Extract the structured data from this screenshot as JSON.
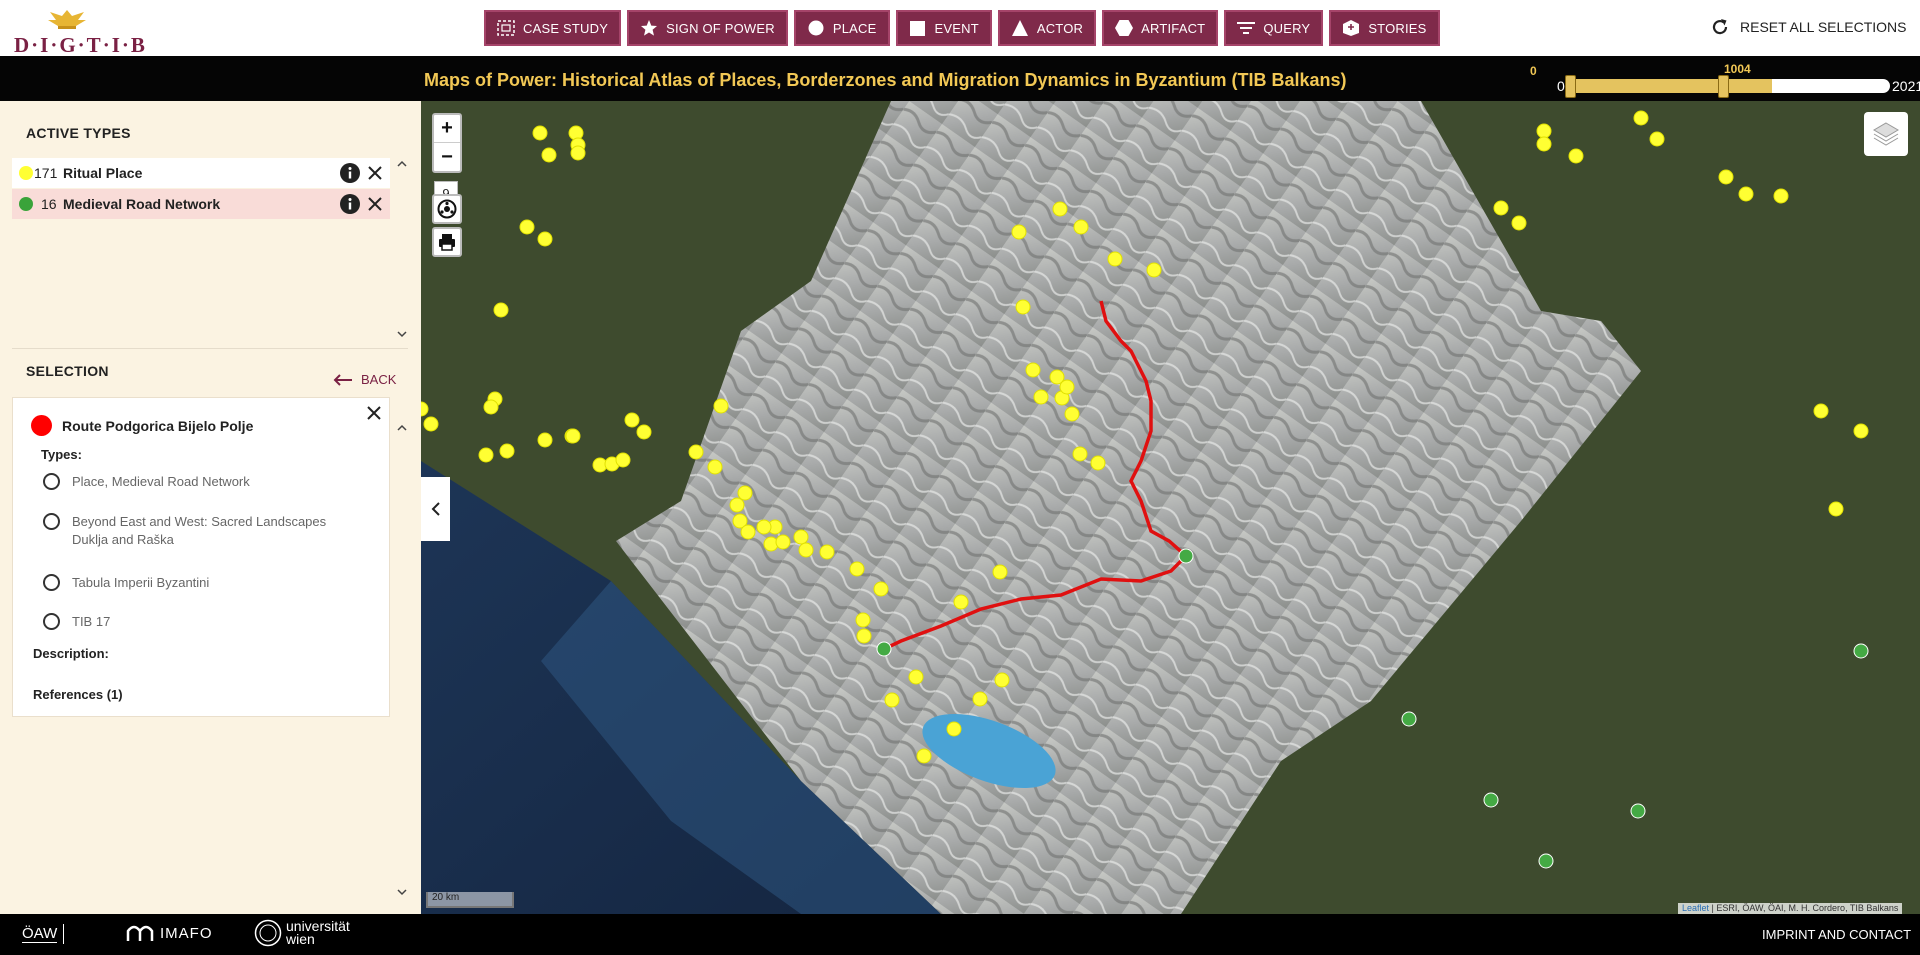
{
  "header": {
    "logo_text": "D·I·G·T·I·B",
    "nav": [
      {
        "label": "CASE STUDY",
        "icon": "case-study-icon"
      },
      {
        "label": "SIGN OF POWER",
        "icon": "star-icon"
      },
      {
        "label": "PLACE",
        "icon": "circle-icon"
      },
      {
        "label": "EVENT",
        "icon": "square-icon"
      },
      {
        "label": "ACTOR",
        "icon": "triangle-icon"
      },
      {
        "label": "ARTIFACT",
        "icon": "hexagon-icon"
      },
      {
        "label": "QUERY",
        "icon": "filter-icon"
      },
      {
        "label": "STORIES",
        "icon": "stories-icon"
      }
    ],
    "reset_label": "RESET ALL SELECTIONS"
  },
  "titlebar": {
    "title": "Maps of Power: Historical Atlas of Places, Borderzones and Migration Dynamics in Byzantium (TIB Balkans)"
  },
  "time_slider": {
    "min_label": "0",
    "value_label": "1004",
    "range_start": "0",
    "range_end": "2021",
    "selected_from": 0,
    "selected_to": 1004
  },
  "sidebar": {
    "active_types_heading": "ACTIVE TYPES",
    "types": [
      {
        "count": "171",
        "label": "Ritual Place",
        "color": "#ffff33",
        "selected": false
      },
      {
        "count": "16",
        "label": "Medieval Road Network",
        "color": "#3aa33a",
        "selected": true
      }
    ],
    "selection_heading": "SELECTION",
    "back_label": "BACK",
    "selection": {
      "title": "Route Podgorica Bijelo Polje",
      "color": "#ff0000",
      "types_heading": "Types:",
      "types": [
        "Place, Medieval Road Network",
        "Beyond East and West: Sacred Landscapes Duklja and Raška",
        "Tabula Imperii Byzantini",
        "TIB 17"
      ],
      "description_heading": "Description:",
      "references_label": "References (1)"
    }
  },
  "map": {
    "zoom_level": "9",
    "scale_label": "20 km",
    "attribution_link": "Leaflet",
    "attribution_text": " | ESRI, ÖAW, ÖAI, M. H. Cordero, TIB Balkans",
    "colors": {
      "ritual_place": "#ffff33",
      "road_node": "#44aa44",
      "route": "#e01010"
    }
  },
  "footer": {
    "oaw_label": "ÖAW",
    "imafo_label": "IMAFO",
    "uni_label_1": "universität",
    "uni_label_2": "wien",
    "imprint_label": "IMPRINT AND CONTACT"
  }
}
